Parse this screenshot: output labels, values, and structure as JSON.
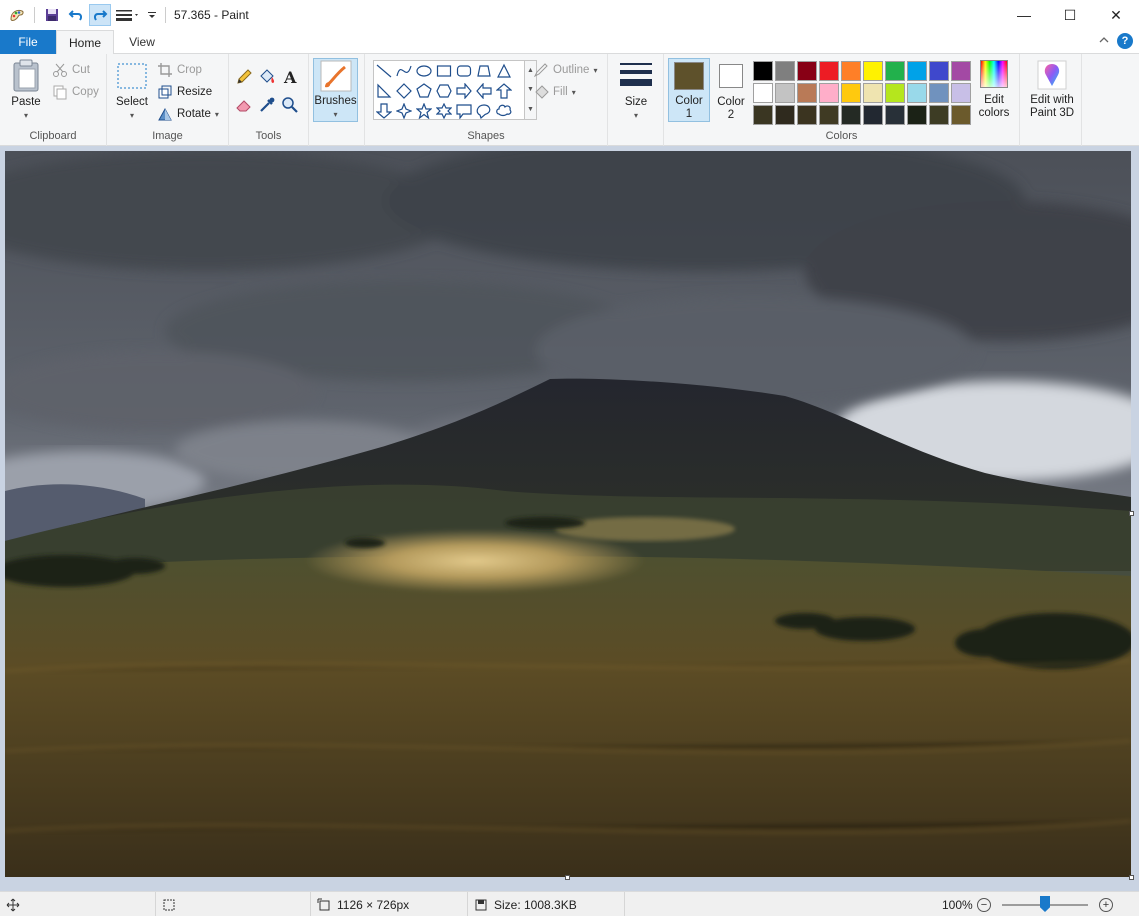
{
  "window": {
    "title": "57.365 - Paint",
    "minimize": "—",
    "maximize": "☐",
    "close": "✕"
  },
  "tabs": {
    "file": "File",
    "home": "Home",
    "view": "View",
    "help": "?"
  },
  "ribbon": {
    "clipboard": {
      "label": "Clipboard",
      "paste": "Paste",
      "cut": "Cut",
      "copy": "Copy"
    },
    "image": {
      "label": "Image",
      "select": "Select",
      "crop": "Crop",
      "resize": "Resize",
      "rotate": "Rotate"
    },
    "tools": {
      "label": "Tools"
    },
    "brushes": {
      "label": "Brushes"
    },
    "shapes": {
      "label": "Shapes",
      "outline": "Outline",
      "fill": "Fill"
    },
    "size": {
      "label": "Size"
    },
    "colors": {
      "label": "Colors",
      "color1_line1": "Color",
      "color1_line2": "1",
      "color2_line1": "Color",
      "color2_line2": "2",
      "edit_line1": "Edit",
      "edit_line2": "colors",
      "color1_value": "#5e512b",
      "color2_value": "#ffffff",
      "palette": [
        "#000000",
        "#7f7f7f",
        "#880015",
        "#ed1c24",
        "#ff7f27",
        "#fff200",
        "#22b14c",
        "#00a2e8",
        "#3f48cc",
        "#a349a4",
        "#ffffff",
        "#c3c3c3",
        "#b97a57",
        "#ffaec9",
        "#ffc90e",
        "#efe4b0",
        "#b5e61d",
        "#99d9ea",
        "#7092be",
        "#c8bfe7",
        "#3a3622",
        "#2f2a1e",
        "#3b3420",
        "#3f3a23",
        "#242a24",
        "#222831",
        "#283038",
        "#1b2216",
        "#3d3c24",
        "#6b5a2c"
      ]
    },
    "paint3d": {
      "line1": "Edit with",
      "line2": "Paint 3D"
    }
  },
  "status": {
    "dimensions": "1126 × 726px",
    "size": "Size: 1008.3KB",
    "zoom": "100%",
    "zoom_level": 100
  }
}
